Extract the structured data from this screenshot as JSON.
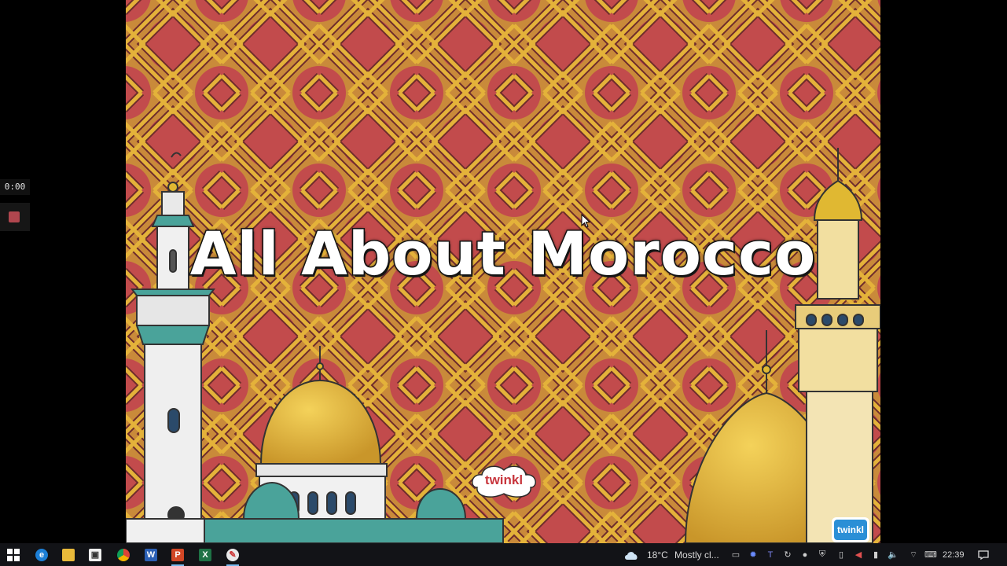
{
  "recorder": {
    "timer": "0:00"
  },
  "slide": {
    "title": "All About Morocco",
    "logo_text": "twinkl",
    "badge_text": "twinkl",
    "colors": {
      "pattern_red": "#c24b4c",
      "pattern_gold": "#e4b23a",
      "pattern_dark": "#6e2c2c",
      "dome_gold": "#e0b832"
    }
  },
  "taskbar": {
    "apps": [
      {
        "name": "start",
        "glyph": "⊞"
      },
      {
        "name": "edge",
        "glyph": "e"
      },
      {
        "name": "file-explorer",
        "glyph": "▬"
      },
      {
        "name": "store",
        "glyph": "▣"
      },
      {
        "name": "chrome",
        "glyph": "●"
      },
      {
        "name": "word",
        "glyph": "W"
      },
      {
        "name": "powerpoint",
        "glyph": "P"
      },
      {
        "name": "excel",
        "glyph": "X"
      },
      {
        "name": "paint",
        "glyph": "✎"
      }
    ],
    "weather": {
      "temperature": "18°C",
      "condition": "Mostly cl..."
    },
    "clock": "22:39"
  }
}
